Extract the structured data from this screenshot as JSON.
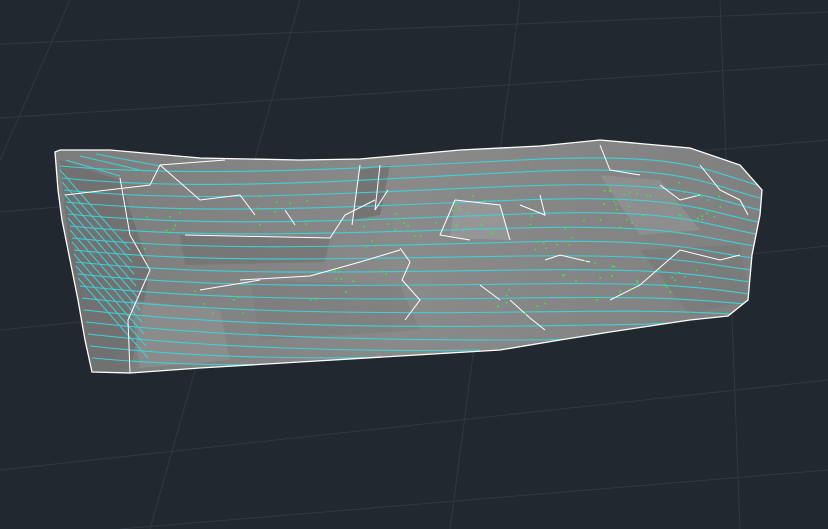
{
  "colors": {
    "background": "#212830",
    "grid_line": "#303843",
    "surface_fill": "#878787",
    "surface_fill_dark": "#6f6f6f",
    "surface_fill_light": "#9a9a9a",
    "contour": "#3fd0d6",
    "breakline": "#ffffff",
    "survey_point": "#39e84a"
  },
  "icons": {
    "surface": "tin-surface-icon",
    "points": "survey-point-icon"
  }
}
